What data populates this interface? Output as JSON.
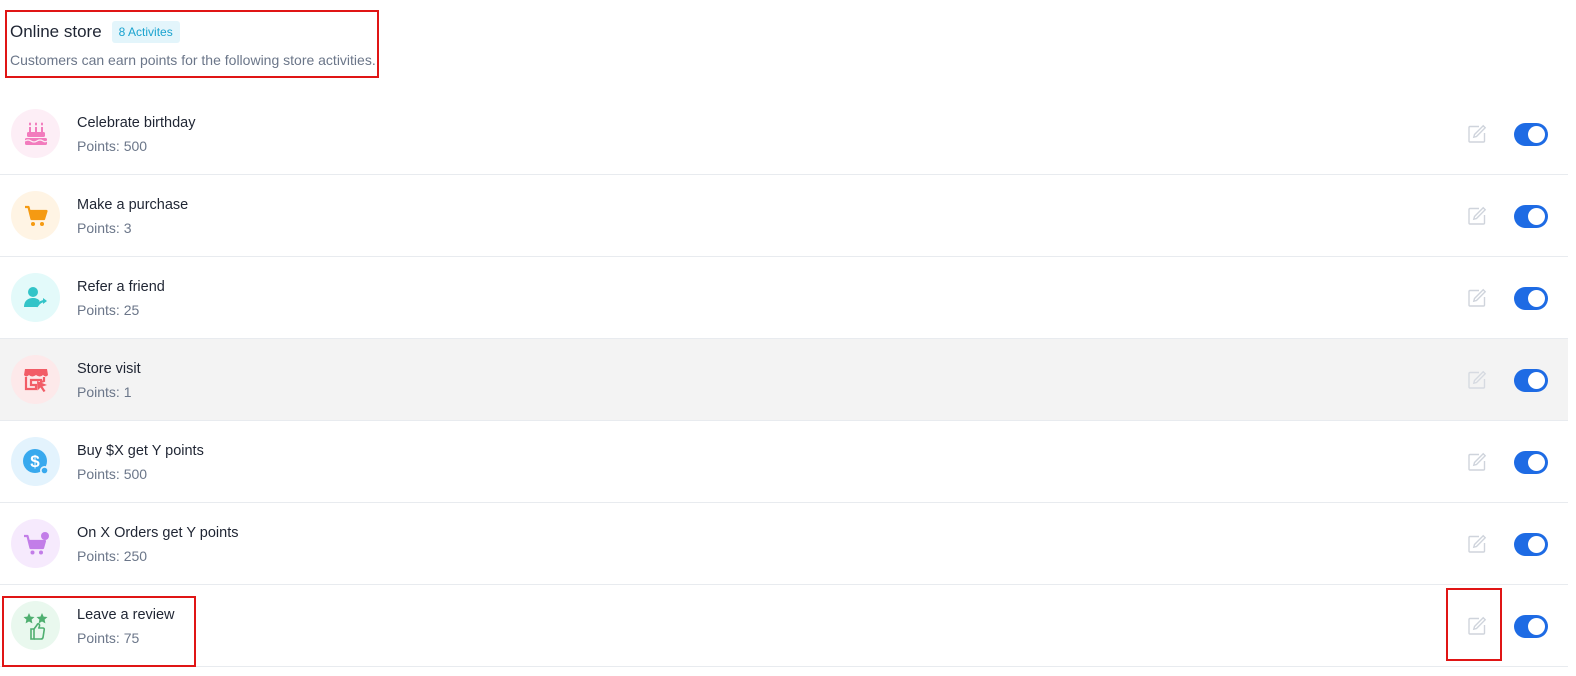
{
  "header": {
    "title": "Online store",
    "badge": "8 Activites",
    "subtitle": "Customers can earn points for the following store activities."
  },
  "activities": [
    {
      "title": "Celebrate birthday",
      "points": "Points: 500",
      "icon": "birthday-cake-icon",
      "bg": "#fdeef6",
      "color": "#f27bbd",
      "enabled": true
    },
    {
      "title": "Make a purchase",
      "points": "Points: 3",
      "icon": "shopping-cart-icon",
      "bg": "#fff4e4",
      "color": "#f59a12",
      "enabled": true
    },
    {
      "title": "Refer a friend",
      "points": "Points: 25",
      "icon": "refer-friend-icon",
      "bg": "#e3fafa",
      "color": "#33c4c8",
      "enabled": true
    },
    {
      "title": "Store visit",
      "points": "Points: 1",
      "icon": "store-visit-icon",
      "bg": "#fde9ea",
      "color": "#f25c66",
      "enabled": true
    },
    {
      "title": "Buy $X get Y points",
      "points": "Points: 500",
      "icon": "dollar-coin-icon",
      "bg": "#e3f3fd",
      "color": "#38a9ee",
      "enabled": true
    },
    {
      "title": "On X Orders get Y points",
      "points": "Points: 250",
      "icon": "cart-plus-icon",
      "bg": "#f6eafd",
      "color": "#c27de8",
      "enabled": true
    },
    {
      "title": "Leave a review",
      "points": "Points: 75",
      "icon": "review-stars-thumb-icon",
      "bg": "#e9f8ee",
      "color": "#4faf70",
      "enabled": true
    }
  ],
  "colors": {
    "accent": "#1e6be4",
    "highlight": "#e01515"
  }
}
